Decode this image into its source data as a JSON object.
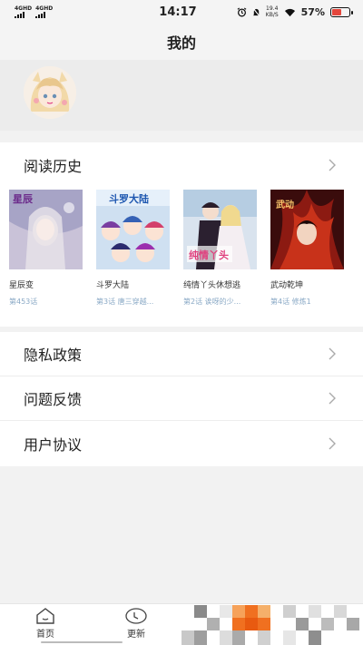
{
  "status_bar": {
    "sim1": "4GHD",
    "sim2": "4GHD",
    "time": "14:17",
    "net_speed_value": "19.4",
    "net_speed_unit": "KB/S",
    "battery_level": "57%",
    "battery_fraction": 0.57
  },
  "header": {
    "title": "我的"
  },
  "history": {
    "title": "阅读历史",
    "books": [
      {
        "title": "星辰变",
        "progress": "第453话",
        "icon": "cover-fantasy"
      },
      {
        "title": "斗罗大陆",
        "progress": "第3话 唐三穿越...",
        "icon": "cover-group"
      },
      {
        "title": "纯情丫头休想逃",
        "progress": "第2话 诶呀的少...",
        "icon": "cover-romance"
      },
      {
        "title": "武动乾坤",
        "progress": "第4话 修炼1",
        "icon": "cover-fire"
      }
    ]
  },
  "menu": [
    {
      "label": "隐私政策"
    },
    {
      "label": "问题反馈"
    },
    {
      "label": "用户协议"
    }
  ],
  "tabbar": {
    "tabs": [
      {
        "label": "首页",
        "icon": "home-icon"
      },
      {
        "label": "更新",
        "icon": "update-icon"
      }
    ]
  },
  "colors": {
    "accent_orange": "#f07020",
    "progress_text": "#8aa9c6",
    "battery_low": "#e4463c"
  }
}
